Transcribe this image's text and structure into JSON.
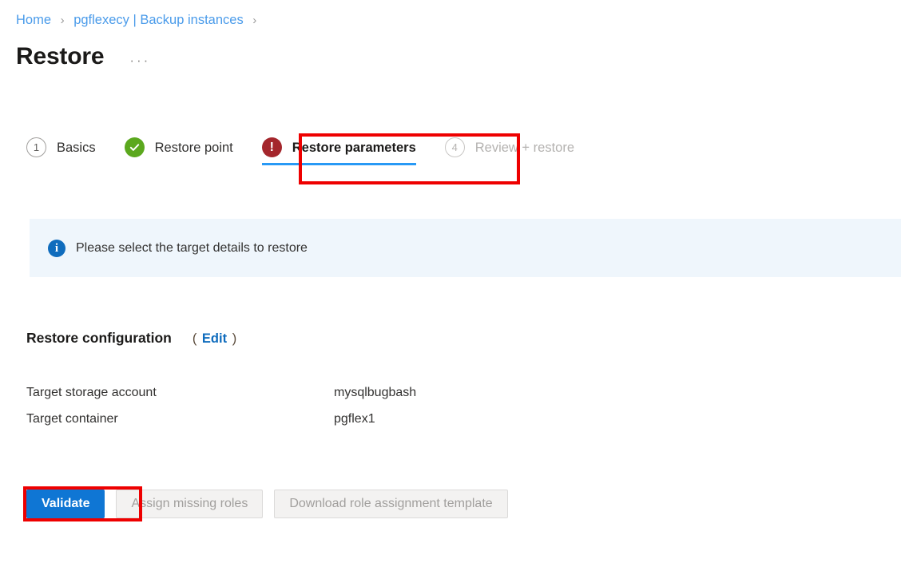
{
  "breadcrumb": {
    "separator": "›",
    "items": [
      {
        "label": "Home"
      },
      {
        "label": "pgflexecy | Backup instances"
      }
    ]
  },
  "header": {
    "title": "Restore",
    "more_menu": "···"
  },
  "wizard": {
    "steps": [
      {
        "badge": "1",
        "label": "Basics",
        "state": "pending"
      },
      {
        "badge": "check-icon",
        "label": "Restore point",
        "state": "done"
      },
      {
        "badge": "error-icon",
        "label": "Restore parameters",
        "state": "active"
      },
      {
        "badge": "4",
        "label": "Review + restore",
        "state": "disabled"
      }
    ]
  },
  "banner": {
    "icon": "info-icon",
    "message": "Please select the target details to restore"
  },
  "config": {
    "title": "Restore configuration",
    "paren_open": "(",
    "edit_label": "Edit",
    "paren_close": ")",
    "rows": [
      {
        "label": "Target storage account",
        "value": "mysqlbugbash"
      },
      {
        "label": "Target container",
        "value": "pgflex1"
      }
    ]
  },
  "actions": [
    {
      "label": "Validate",
      "style": "primary"
    },
    {
      "label": "Assign missing roles",
      "style": "disabled"
    },
    {
      "label": "Download role assignment template",
      "style": "disabled"
    }
  ],
  "colors": {
    "link": "#4a9bea",
    "accent": "#0f76d4",
    "success": "#5ba81e",
    "error": "#a4262c",
    "info": "#0f6cbd",
    "banner_bg": "#eff6fc",
    "annotation": "#ee0000"
  }
}
